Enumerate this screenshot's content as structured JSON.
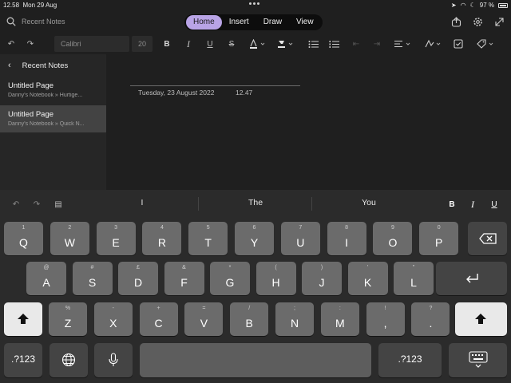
{
  "status": {
    "time": "12.58",
    "date": "Mon 29 Aug",
    "battery": "97 %"
  },
  "topbar": {
    "search_placeholder": "Recent Notes",
    "tabs": [
      {
        "label": "Home",
        "active": true
      },
      {
        "label": "Insert"
      },
      {
        "label": "Draw"
      },
      {
        "label": "View"
      }
    ]
  },
  "ribbon": {
    "font": "Calibri",
    "size": "20",
    "bold": "B",
    "italic": "I",
    "underline": "U",
    "strike": "S"
  },
  "sidebar": {
    "title": "Recent Notes",
    "items": [
      {
        "title": "Untitled Page",
        "path": "Danny's Notebook » Hurtige..."
      },
      {
        "title": "Untitled Page",
        "path": "Danny's Notebook » Quick N...",
        "selected": true
      }
    ]
  },
  "page": {
    "date": "Tuesday, 23 August 2022",
    "time": "12.47"
  },
  "keyboard": {
    "predictions": [
      "I",
      "The",
      "You"
    ],
    "format": {
      "bold": "B",
      "italic": "I",
      "underline": "U"
    },
    "row1": [
      {
        "k": "Q",
        "h": "1"
      },
      {
        "k": "W",
        "h": "2"
      },
      {
        "k": "E",
        "h": "3"
      },
      {
        "k": "R",
        "h": "4"
      },
      {
        "k": "T",
        "h": "5"
      },
      {
        "k": "Y",
        "h": "6"
      },
      {
        "k": "U",
        "h": "7"
      },
      {
        "k": "I",
        "h": "8"
      },
      {
        "k": "O",
        "h": "9"
      },
      {
        "k": "P",
        "h": "0"
      }
    ],
    "row2": [
      {
        "k": "A",
        "h": "@"
      },
      {
        "k": "S",
        "h": "#"
      },
      {
        "k": "D",
        "h": "£"
      },
      {
        "k": "F",
        "h": "&"
      },
      {
        "k": "G",
        "h": "*"
      },
      {
        "k": "H",
        "h": "("
      },
      {
        "k": "J",
        "h": ")"
      },
      {
        "k": "K",
        "h": "'"
      },
      {
        "k": "L",
        "h": "\""
      }
    ],
    "row3": [
      {
        "k": "Z",
        "h": "%"
      },
      {
        "k": "X",
        "h": "-"
      },
      {
        "k": "C",
        "h": "+"
      },
      {
        "k": "V",
        "h": "="
      },
      {
        "k": "B",
        "h": "/"
      },
      {
        "k": "N",
        "h": ";"
      },
      {
        "k": "M",
        "h": ":"
      },
      {
        "k": ",",
        "h": "!"
      },
      {
        "k": ".",
        "h": "?"
      }
    ],
    "num_label": ".?123"
  }
}
